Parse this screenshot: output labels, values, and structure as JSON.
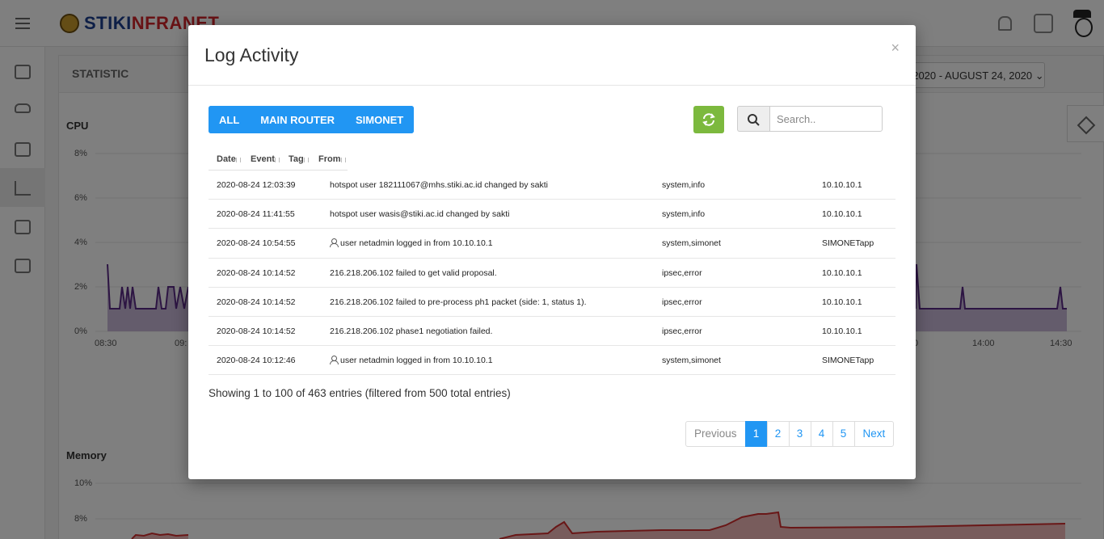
{
  "app": {
    "logo": {
      "part1": "STIKI",
      "part2": "NFRANET"
    },
    "panel_title": "STATISTIC",
    "date_range": ", 2020 - AUGUST 24, 2020",
    "cpu": {
      "label": "CPU",
      "yticks": [
        "8%",
        "6%",
        "4%",
        "2%",
        "0%"
      ],
      "xticks_left": [
        "08:30",
        "09:"
      ],
      "xticks_right": [
        "0",
        "14:00",
        "14:30"
      ]
    },
    "memory": {
      "label": "Memory",
      "yticks": [
        "10%",
        "8%"
      ]
    }
  },
  "modal": {
    "title": "Log Activity",
    "close": "×",
    "filters": [
      "ALL",
      "MAIN ROUTER",
      "SIMONET"
    ],
    "search_placeholder": "Search..",
    "columns": [
      "Date",
      "Event",
      "Tag",
      "From"
    ],
    "rows": [
      {
        "date": "2020-08-24 12:03:39",
        "event": "hotspot user 182111067@mhs.stiki.ac.id changed by sakti",
        "tag": "system,info",
        "from": "10.10.10.1",
        "user_icon": false
      },
      {
        "date": "2020-08-24 11:41:55",
        "event": "hotspot user wasis@stiki.ac.id changed by sakti",
        "tag": "system,info",
        "from": "10.10.10.1",
        "user_icon": false
      },
      {
        "date": "2020-08-24 10:54:55",
        "event": "user netadmin logged in from 10.10.10.1",
        "tag": "system,simonet",
        "from": "SIMONETapp",
        "user_icon": true
      },
      {
        "date": "2020-08-24 10:14:52",
        "event": "216.218.206.102 failed to get valid proposal.",
        "tag": "ipsec,error",
        "from": "10.10.10.1",
        "user_icon": false
      },
      {
        "date": "2020-08-24 10:14:52",
        "event": "216.218.206.102 failed to pre-process ph1 packet (side: 1, status 1).",
        "tag": "ipsec,error",
        "from": "10.10.10.1",
        "user_icon": false
      },
      {
        "date": "2020-08-24 10:14:52",
        "event": "216.218.206.102 phase1 negotiation failed.",
        "tag": "ipsec,error",
        "from": "10.10.10.1",
        "user_icon": false
      },
      {
        "date": "2020-08-24 10:12:46",
        "event": "user netadmin logged in from 10.10.10.1",
        "tag": "system,simonet",
        "from": "SIMONETapp",
        "user_icon": true
      }
    ],
    "info": "Showing 1 to 100 of 463 entries (filtered from 500 total entries)",
    "pagination": {
      "previous": "Previous",
      "pages": [
        "1",
        "2",
        "3",
        "4",
        "5"
      ],
      "next": "Next",
      "active": "1"
    }
  },
  "colors": {
    "primary": "#2196f3",
    "success": "#7cb93e",
    "cpu_line": "#5b2a86",
    "memory_line": "#d32f2f"
  }
}
